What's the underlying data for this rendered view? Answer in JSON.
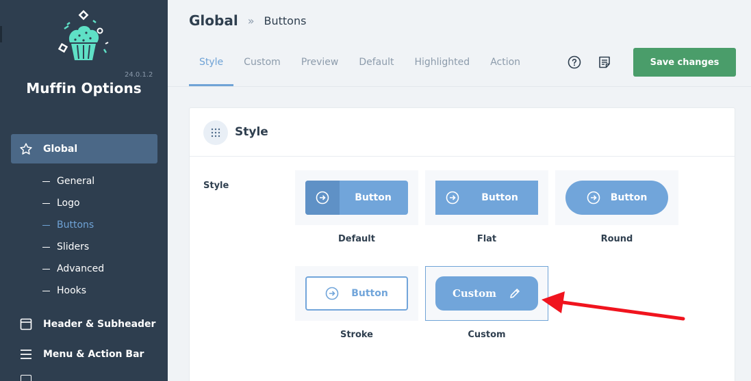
{
  "sidebar": {
    "version": "24.0.1.2",
    "brand": "Muffin Options",
    "main_items": [
      {
        "label": "Global",
        "icon": "star-icon"
      },
      {
        "label": "Header & Subheader",
        "icon": "window-icon"
      },
      {
        "label": "Menu & Action Bar",
        "icon": "menu-icon"
      }
    ],
    "sub_items": [
      {
        "label": "General"
      },
      {
        "label": "Logo"
      },
      {
        "label": "Buttons"
      },
      {
        "label": "Sliders"
      },
      {
        "label": "Advanced"
      },
      {
        "label": "Hooks"
      }
    ]
  },
  "header": {
    "breadcrumb_main": "Global",
    "breadcrumb_sep": "»",
    "breadcrumb_sub": "Buttons",
    "tabs": [
      {
        "label": "Style"
      },
      {
        "label": "Custom"
      },
      {
        "label": "Preview"
      },
      {
        "label": "Default"
      },
      {
        "label": "Highlighted"
      },
      {
        "label": "Action"
      }
    ],
    "active_tab": "Style",
    "save_label": "Save changes"
  },
  "panel": {
    "title": "Style",
    "field_label": "Style",
    "options": [
      {
        "label": "Default",
        "button_text": "Button"
      },
      {
        "label": "Flat",
        "button_text": "Button"
      },
      {
        "label": "Round",
        "button_text": "Button"
      },
      {
        "label": "Stroke",
        "button_text": "Button"
      },
      {
        "label": "Custom",
        "button_text": "Custom"
      }
    ],
    "selected": "Custom"
  },
  "colors": {
    "sidebar_bg": "#2e3e4f",
    "accent": "#6fa3d6",
    "save_green": "#4a9d6a",
    "annotation_arrow": "#f0141e"
  }
}
